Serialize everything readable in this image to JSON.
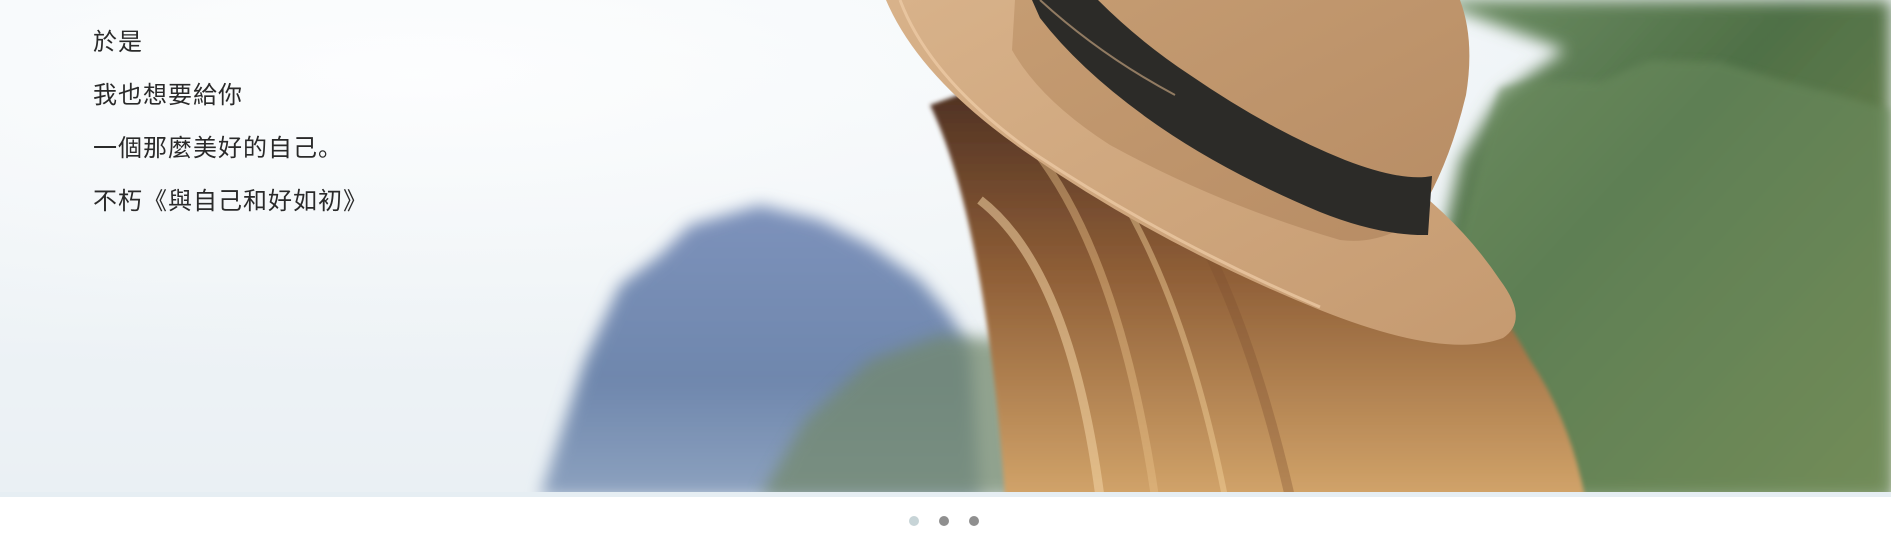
{
  "hero": {
    "lines": [
      "於是",
      "我也想要給你",
      "一個那麼美好的自己。",
      "不朽《與自己和好如初》"
    ]
  },
  "pager": {
    "dots": [
      {
        "state": "active"
      },
      {
        "state": "inactive"
      },
      {
        "state": "inactive"
      }
    ]
  }
}
